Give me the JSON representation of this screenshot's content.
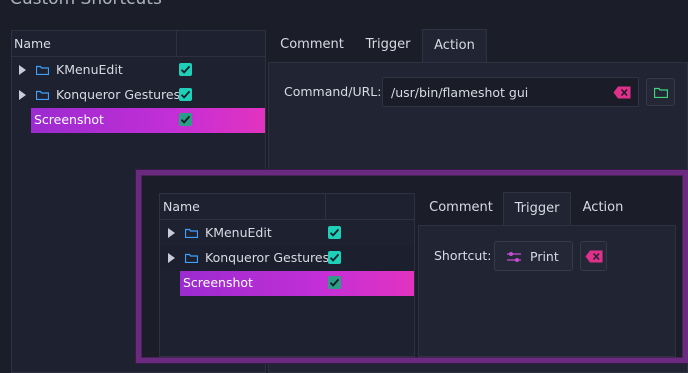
{
  "window": {
    "title": "Custom Shortcuts"
  },
  "tree": {
    "header": "Name",
    "items": [
      {
        "label": "KMenuEdit",
        "checked": true
      },
      {
        "label": "Konqueror Gestures",
        "checked": true
      },
      {
        "label": "Screenshot",
        "checked": true
      }
    ]
  },
  "tabs": [
    "Comment",
    "Trigger",
    "Action"
  ],
  "back": {
    "active_tab": "Action",
    "command_label": "Command/URL:",
    "command_value": "/usr/bin/flameshot gui"
  },
  "front": {
    "active_tab": "Trigger",
    "shortcut_label": "Shortcut:",
    "shortcut_value": "Print"
  },
  "colors": {
    "accent_teal": "#1fd0b8",
    "selection_start": "#9b2bd0",
    "selection_end": "#e233c0",
    "folder_blue": "#3fa0ff",
    "clear_icon": "#e0308a"
  }
}
